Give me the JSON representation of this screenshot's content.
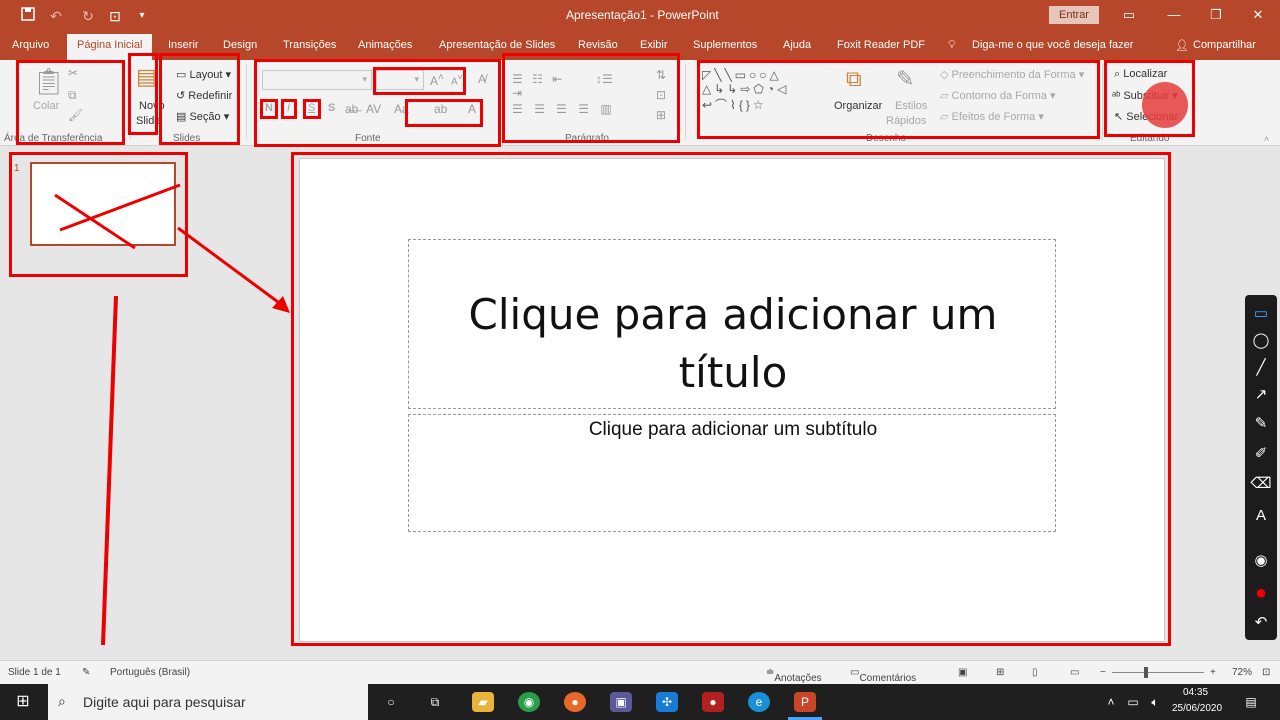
{
  "window": {
    "title": "Apresentação1  -  PowerPoint",
    "signin": "Entrar"
  },
  "tabs": [
    "Arquivo",
    "Página Inicial",
    "Inserir",
    "Design",
    "Transições",
    "Animações",
    "Apresentação de Slides",
    "Revisão",
    "Exibir",
    "Suplementos",
    "Ajuda",
    "Foxit Reader PDF",
    "Diga-me o que você deseja fazer",
    "Compartilhar"
  ],
  "ribbon": {
    "clipboard": {
      "paste": "Colar",
      "group": "Área de Transferência"
    },
    "slides": {
      "new": "Novo",
      "new2": "Slide",
      "layout": "Layout",
      "reset": "Redefinir",
      "section": "Seção",
      "group": "Slides"
    },
    "font": {
      "bold": "N",
      "italic": "I",
      "underline": "S",
      "strike": "S",
      "group": "Fonte"
    },
    "paragraph": {
      "group": "Parágrafo"
    },
    "drawing": {
      "arrange": "Organizar",
      "styles": "Estilos",
      "styles2": "Rápidos",
      "fill": "Preenchimento da Forma",
      "outline": "Contorno da Forma",
      "effects": "Efeitos de Forma",
      "group": "Desenho"
    },
    "editing": {
      "find": "Localizar",
      "replace": "Substituir",
      "select": "Selecionar",
      "group": "Editando"
    }
  },
  "thumbs": {
    "num": "1"
  },
  "slide": {
    "title": "Clique para adicionar um título",
    "subtitle": "Clique para adicionar um subtítulo"
  },
  "status": {
    "slide": "Slide 1 de 1",
    "lang": "Português (Brasil)",
    "notes": "Anotações",
    "comments": "Comentários",
    "zoom": "72%"
  },
  "taskbar": {
    "search": "Digite aqui para pesquisar",
    "time": "04:35",
    "date": "25/06/2020"
  },
  "colors": {
    "accent": "#b7472a",
    "annotation": "#e00000"
  }
}
